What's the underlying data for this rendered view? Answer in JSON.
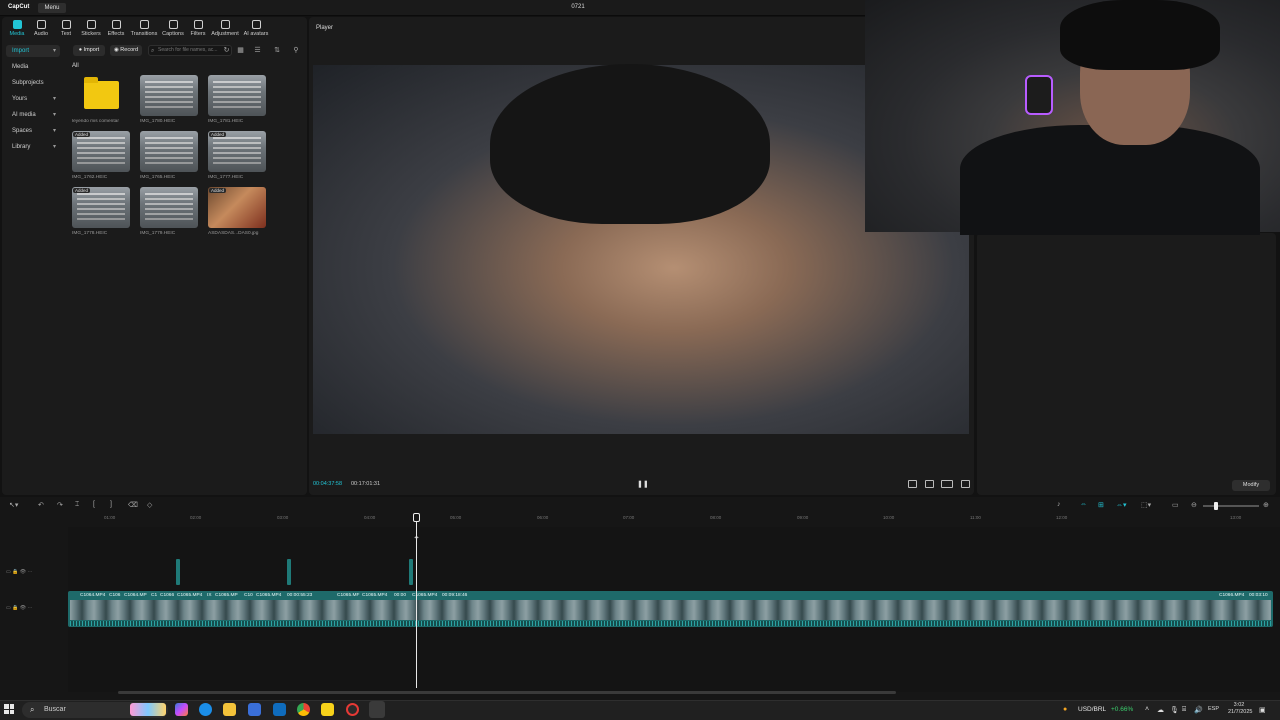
{
  "app": {
    "logo": "CapCut",
    "menu_label": "Menu",
    "project_title": "0721"
  },
  "tool_tabs": [
    {
      "label": "Media",
      "icon": "media-icon",
      "active": true
    },
    {
      "label": "Audio",
      "icon": "audio-icon"
    },
    {
      "label": "Text",
      "icon": "text-icon"
    },
    {
      "label": "Stickers",
      "icon": "sticker-icon"
    },
    {
      "label": "Effects",
      "icon": "effects-icon"
    },
    {
      "label": "Transitions",
      "icon": "transitions-icon"
    },
    {
      "label": "Captions",
      "icon": "captions-icon"
    },
    {
      "label": "Filters",
      "icon": "filters-icon"
    },
    {
      "label": "Adjustment",
      "icon": "adjustment-icon"
    },
    {
      "label": "AI avatars",
      "icon": "ai-avatar-icon"
    }
  ],
  "side_nav": [
    {
      "label": "Import",
      "active": true,
      "chevron": true
    },
    {
      "label": "Media"
    },
    {
      "label": "Subprojects"
    },
    {
      "label": "Yours",
      "chevron": true
    },
    {
      "label": "AI media",
      "chevron": true
    },
    {
      "label": "Spaces",
      "chevron": true
    },
    {
      "label": "Library",
      "chevron": true
    }
  ],
  "media_toolbar": {
    "import_label": "Import",
    "record_label": "Record",
    "search_placeholder": "Search for file names, ac..."
  },
  "media_filter_label": "All",
  "media_items": [
    {
      "name": "leyendo mis comentar",
      "kind": "folder"
    },
    {
      "name": "IMG_1780.HEIC",
      "kind": "doc"
    },
    {
      "name": "IMG_1781.HEIC",
      "kind": "doc"
    },
    {
      "name": "IMG_1762.HEIC",
      "kind": "doc",
      "added": true
    },
    {
      "name": "IMG_1765.HEIC",
      "kind": "doc"
    },
    {
      "name": "IMG_1777.HEIC",
      "kind": "doc",
      "added": true
    },
    {
      "name": "IMG_1778.HEIC",
      "kind": "doc",
      "added": true
    },
    {
      "name": "IMG_1779.HEIC",
      "kind": "doc"
    },
    {
      "name": "ASDASDAS...DAS0.jpg",
      "kind": "photo",
      "added": true
    }
  ],
  "added_badge": "Added",
  "player": {
    "title": "Player",
    "current_time": "00:04:37:58",
    "total_time": "00:17:01:31"
  },
  "details": {
    "modify_label": "Modify"
  },
  "timeline": {
    "ruler": [
      "01:00",
      "02:00",
      "03:00",
      "04:00",
      "05:00",
      "06:00",
      "07:00",
      "08:00",
      "09:00",
      "10:00",
      "11:00",
      "12:00",
      "13:00"
    ],
    "clip_labels": [
      "C1064.MP4",
      "C106",
      "C1064.MP",
      "C1",
      "C1066",
      "C1065.MP4",
      "IX",
      "C1065.MP",
      "C10",
      "C1065.MP4",
      "00:00:55:23",
      "C1065.MF",
      "C1065.MP4",
      "00:00",
      "C1065.MP4",
      "00:09:18:46",
      "C1066.MP4",
      "00:03:10"
    ]
  },
  "taskbar": {
    "search_placeholder": "Buscar",
    "fx_pair": "USD/BRL",
    "fx_change": "+0.66%",
    "language": "ESP",
    "time": "3:02",
    "date": "21/7/2025"
  }
}
